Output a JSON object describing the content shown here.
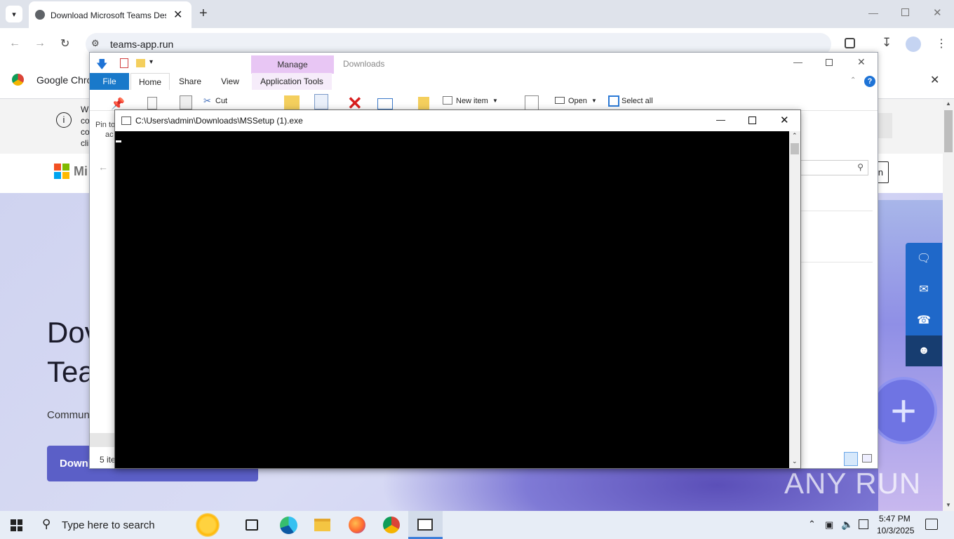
{
  "browser": {
    "tab_title": "Download Microsoft Teams Des",
    "url": "teams-app.run",
    "infobar_title": "Google Chrome",
    "infobar_message_fragments": [
      "W",
      "co",
      "co",
      "cli"
    ]
  },
  "webpage": {
    "logo_text": "Mi",
    "hero_title_line1": "Dov",
    "hero_title_line2": "Tea",
    "hero_sub": "Commun",
    "download_button": "Downl",
    "signin_fragment": "n",
    "accent_color": "#5b5fc7"
  },
  "explorer": {
    "title": "Downloads",
    "manage_tab": "Manage",
    "tabs": [
      "File",
      "Home",
      "Share",
      "View",
      "Application Tools"
    ],
    "ribbon": {
      "pin_label": "Pin to",
      "pin_label2": "ac",
      "cut_label": "Cut",
      "new_item_label": "New item",
      "open_label": "Open",
      "select_all_label": "Select all"
    },
    "status_items": "5 ite"
  },
  "console": {
    "title": "C:\\Users\\admin\\Downloads\\MSSetup (1).exe",
    "background": "#000000"
  },
  "taskbar": {
    "search_placeholder": "Type here to search",
    "time": "5:47 PM",
    "date": "10/3/2025"
  },
  "watermark": "ANY RUN"
}
